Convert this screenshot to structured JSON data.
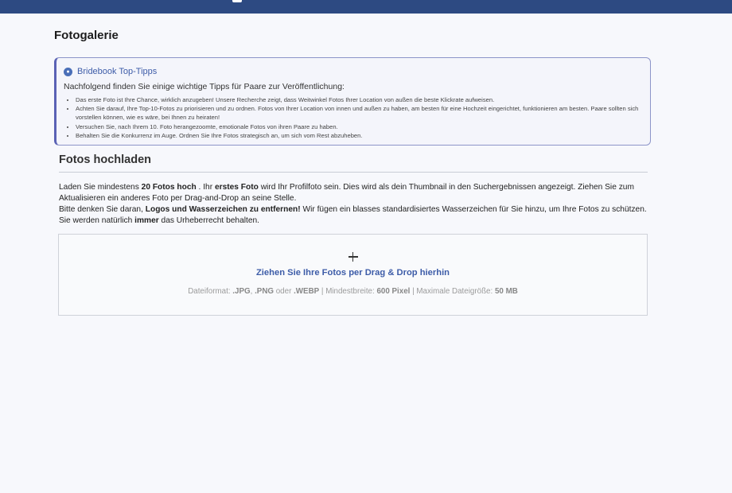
{
  "page": {
    "title": "Fotogalerie"
  },
  "tips": {
    "title": "Bridebook Top-Tipps",
    "intro": "Nachfolgend finden Sie einige wichtige Tipps für Paare zur Veröffentlichung:",
    "items": [
      "Das erste Foto ist Ihre Chance, wirklich anzugeben! Unsere Recherche zeigt, dass Weitwinkel Fotos Ihrer Location von außen die beste Klickrate aufweisen.",
      "Achten Sie darauf, Ihre Top-10-Fotos zu priorisieren und zu ordnen. Fotos von Ihrer Location von innen und außen zu haben, am besten für eine Hochzeit eingerichtet, funktionieren am besten. Paare sollten sich vorstellen können, wie es wäre, bei Ihnen zu heiraten!",
      "Versuchen Sie, nach Ihrem 10. Foto herangezoomte, emotionale Fotos von ihren Paare zu haben.",
      "Behalten Sie die Konkurrenz im Auge. Ordnen Sie Ihre Fotos strategisch an, um sich vom Rest abzuheben."
    ]
  },
  "upload": {
    "title": "Fotos hochladen",
    "p1_a": "Laden Sie mindestens ",
    "p1_b": "20 Fotos hoch",
    "p1_c": " . Ihr ",
    "p1_d": "erstes Foto",
    "p1_e": " wird Ihr Profilfoto sein. Dies wird als dein Thumbnail in den Suchergebnissen angezeigt. Ziehen Sie zum Aktualisieren ein anderes Foto per Drag-and-Drop an seine Stelle.",
    "p2_a": "Bitte denken Sie daran, ",
    "p2_b": "Logos und Wasserzeichen zu entfernen!",
    "p2_c": " Wir fügen ein blasses standardisiertes Wasserzeichen für Sie hinzu, um Ihre Fotos zu schützen. Sie werden natürlich ",
    "p2_d": "immer",
    "p2_e": " das Urheberrecht behalten."
  },
  "dropzone": {
    "label": "Ziehen Sie Ihre Fotos per Drag & Drop hierhin",
    "meta_prefix": "Dateiformat: ",
    "fmt_jpg": ".JPG",
    "sep1": ", ",
    "fmt_png": ".PNG",
    "or_word": " oder ",
    "fmt_webp": ".WEBP",
    "sep2": " | Mindestbreite: ",
    "min_width": "600 Pixel",
    "sep3": " | Maximale Dateigröße: ",
    "max_size": "50 MB"
  },
  "colors": {
    "topbar": "#2d4a82",
    "accent": "#3d5ca8",
    "tips_border": "#5a62b5"
  },
  "icons": {
    "tips": "bridebook-logo-icon",
    "add": "plus-icon"
  }
}
